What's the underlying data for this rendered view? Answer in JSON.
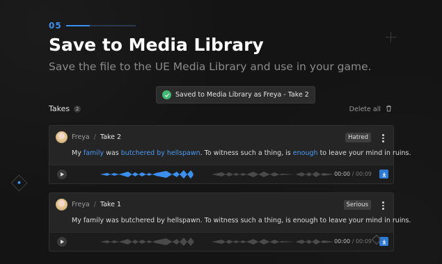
{
  "step": {
    "number": "05"
  },
  "header": {
    "title": "Save to Media Library",
    "subtitle": "Save the file to the UE Media Library and use in your game."
  },
  "toast": {
    "message": "Saved to Media Library as Freya - Take 2"
  },
  "takes": {
    "label": "Takes",
    "count": "2",
    "delete_all": "Delete all",
    "items": [
      {
        "speaker": "Freya",
        "separator": "/",
        "take": "Take 2",
        "tag": "Hatred",
        "line_segments": [
          {
            "text": "My ",
            "hl": false
          },
          {
            "text": "family",
            "hl": true
          },
          {
            "text": " was ",
            "hl": false
          },
          {
            "text": "butchered by hellspawn",
            "hl": true
          },
          {
            "text": ". To witness such a thing, is ",
            "hl": false
          },
          {
            "text": "enough",
            "hl": true
          },
          {
            "text": " to leave your mind in ruins.",
            "hl": false
          }
        ],
        "time_current": "00:00",
        "time_sep": " / ",
        "time_total": "00:09"
      },
      {
        "speaker": "Freya",
        "separator": "/",
        "take": "Take 1",
        "tag": "Serious",
        "line_segments": [
          {
            "text": "My family was butchered by hellspawn. To witness such a thing, is enough to leave your mind in ruins.",
            "hl": false
          }
        ],
        "time_current": "00:00",
        "time_sep": " / ",
        "time_total": "00:09"
      }
    ]
  },
  "colors": {
    "accent": "#3a8ff0",
    "success": "#41b871",
    "highlight": "#4a9af2",
    "background": "#141414"
  },
  "icons": {
    "toast": "check-circle-icon",
    "delete": "trash-icon",
    "menu": "kebab-icon",
    "play": "play-icon",
    "download": "download-icon"
  }
}
